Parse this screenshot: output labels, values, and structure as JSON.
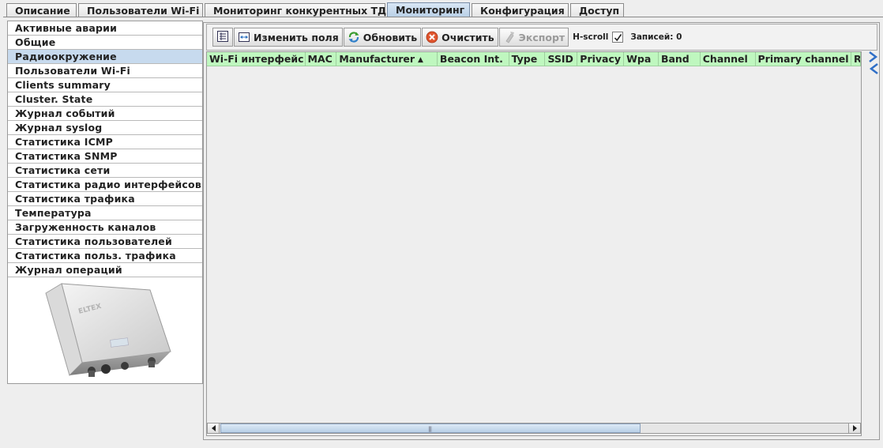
{
  "tabs": [
    {
      "label": "Описание",
      "active": false
    },
    {
      "label": "Пользователи Wi-Fi",
      "active": false
    },
    {
      "label": "Мониторинг конкурентных ТД",
      "active": false
    },
    {
      "label": "Мониторинг",
      "active": true
    },
    {
      "label": "Конфигурация",
      "active": false
    },
    {
      "label": "Доступ",
      "active": false
    }
  ],
  "sidebar": {
    "items": [
      "Активные аварии",
      "Общие",
      "Радиоокружение",
      "Пользователи Wi-Fi",
      "Clients summary",
      "Cluster. State",
      "Журнал событий",
      "Журнал syslog",
      "Статистика ICMP",
      "Статистика SNMP",
      "Статистика сети",
      "Статистика радио интерфейсов",
      "Статистика трафика",
      "Температура",
      "Загруженность каналов",
      "Статистика пользователей",
      "Статистика польз. трафика",
      "Журнал операций"
    ],
    "active_index": 2,
    "device_logo": "ELTEX"
  },
  "toolbar": {
    "edit_fields_label": "Изменить поля",
    "refresh_label": "Обновить",
    "clear_label": "Очистить",
    "export_label": "Экспорт",
    "hscroll_label": "H-scroll",
    "hscroll_checked": true,
    "records_label": "Записей: 0"
  },
  "table": {
    "columns": [
      {
        "label": "Wi-Fi интерфейс",
        "sorted": false
      },
      {
        "label": "MAC",
        "sorted": false
      },
      {
        "label": "Manufacturer",
        "sorted": true
      },
      {
        "label": "Beacon Int.",
        "sorted": false
      },
      {
        "label": "Type",
        "sorted": false
      },
      {
        "label": "SSID",
        "sorted": false
      },
      {
        "label": "Privacy",
        "sorted": false
      },
      {
        "label": "Wpa",
        "sorted": false
      },
      {
        "label": "Band",
        "sorted": false
      },
      {
        "label": "Channel",
        "sorted": false
      },
      {
        "label": "Primary channel",
        "sorted": false
      },
      {
        "label": "R",
        "sorted": false
      }
    ],
    "rows": []
  },
  "colors": {
    "header_bg": "#bff7bf",
    "selected_bg": "#c7daee",
    "active_tab_bg": "#b8cfe6"
  }
}
